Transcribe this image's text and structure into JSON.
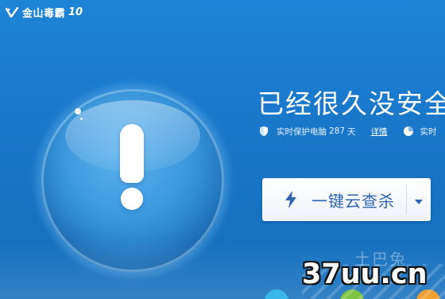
{
  "title_bar": {
    "app_name": "金山毒霸",
    "version": "10",
    "logo_icon": "duba-v-logo-icon"
  },
  "status": {
    "orb_icon": "exclamation-warning-icon",
    "headline": "已经很久没安全",
    "protect_label": "实时保护电脑",
    "protect_days": "287",
    "days_unit": "天",
    "details_link": "详情",
    "second_label": "实时",
    "shield_icon": "shield-icon",
    "dial_icon": "dial-icon"
  },
  "scan": {
    "button_label": "一键云查杀",
    "bolt_icon": "lightning-bolt-icon",
    "dropdown_icon": "caret-down-icon"
  },
  "watermark": {
    "brand_cn": "土巴兔",
    "site": "37uu.cn"
  },
  "colors": {
    "background": "#1a79cc",
    "button_text": "#2f66b3",
    "orb": "#3896dc"
  }
}
